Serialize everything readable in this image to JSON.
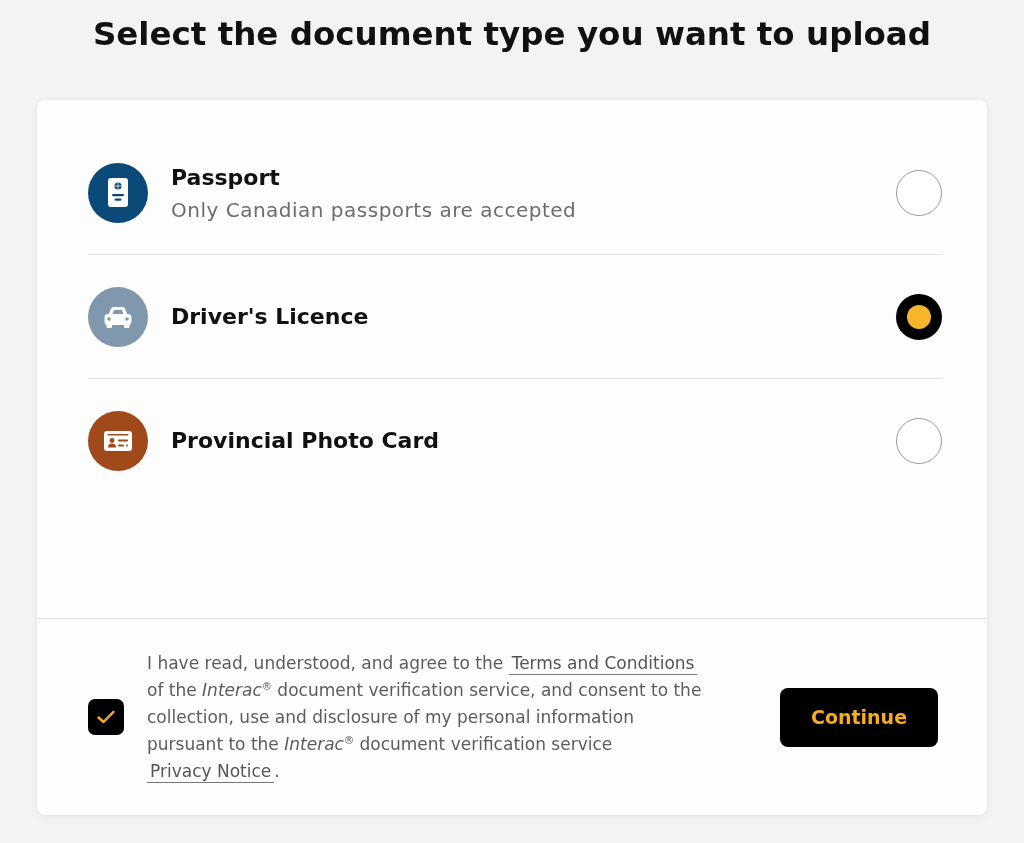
{
  "title": "Select the document type you want to upload",
  "options": [
    {
      "kind": "passport",
      "title": "Passport",
      "subtitle": "Only Canadian passports are accepted",
      "color": "#0b4a78",
      "selected": false
    },
    {
      "kind": "car",
      "title": "Driver's Licence",
      "color": "#7f98ad",
      "selected": true
    },
    {
      "kind": "id-card",
      "title": "Provincial Photo Card",
      "color": "#a0491a",
      "selected": false
    }
  ],
  "consent": {
    "checked": true,
    "parts": [
      {
        "kind": "text",
        "text": "I have read, understood, and agree to the "
      },
      {
        "kind": "link",
        "text": "Terms and Conditions"
      },
      {
        "kind": "text",
        "text": " of the *Interac*$^{®}$ document verification service, and consent to the collection, use and disclosure of my personal information pursuant to the *Interac*$^{®}$ document verification service "
      },
      {
        "kind": "link",
        "text": "Privacy Notice"
      },
      {
        "kind": "text",
        "text": "."
      }
    ]
  },
  "continue_button": "Continue"
}
